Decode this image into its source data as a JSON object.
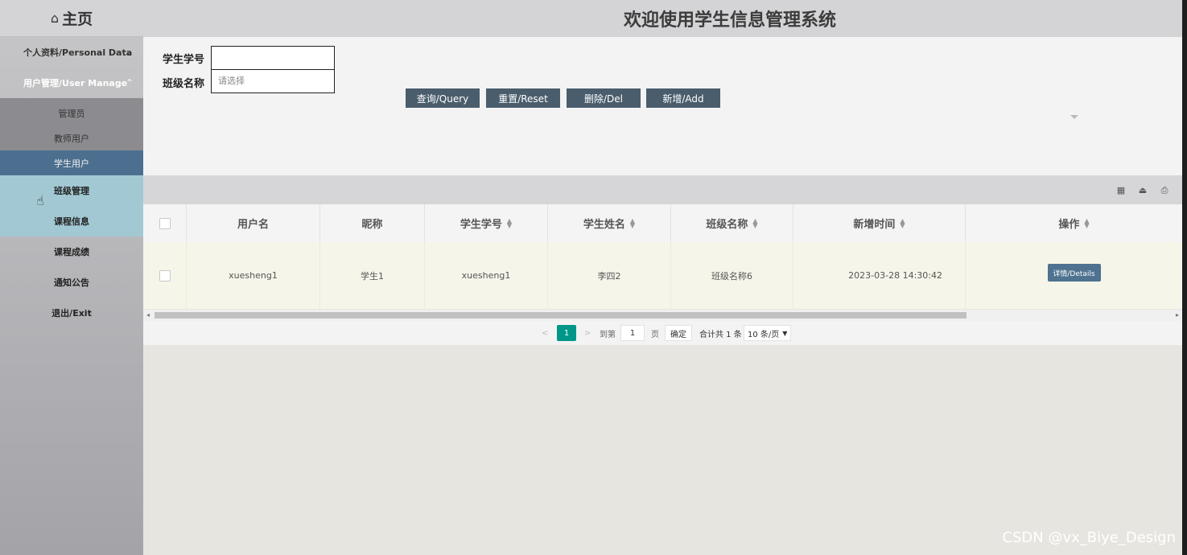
{
  "sidebar": {
    "home": {
      "icon": "home-icon",
      "label": "主页"
    },
    "menus": [
      {
        "label": "个人资料/Personal Data"
      },
      {
        "label": "用户管理/User Manage"
      }
    ],
    "sub_items": [
      {
        "label": "管理员"
      },
      {
        "label": "教师用户"
      },
      {
        "label": "学生用户"
      }
    ],
    "links": [
      {
        "label": "班级管理"
      },
      {
        "label": "课程信息"
      },
      {
        "label": "课程成绩"
      },
      {
        "label": "通知公告"
      },
      {
        "label": "退出/Exit"
      }
    ]
  },
  "header": {
    "title": "欢迎使用学生信息管理系统"
  },
  "search": {
    "student_id_label": "学生学号",
    "student_id_value": "",
    "class_label": "班级名称",
    "class_placeholder": "请选择",
    "buttons": {
      "query": "查询/Query",
      "reset": "重置/Reset",
      "delete": "删除/Del",
      "add": "新增/Add"
    }
  },
  "table": {
    "columns": [
      "用户名",
      "昵称",
      "学生学号",
      "学生姓名",
      "班级名称",
      "新增时间",
      "操作"
    ],
    "rows": [
      {
        "username": "xuesheng1",
        "nickname": "学生1",
        "student_id": "xuesheng1",
        "student_name": "李四2",
        "class_name": "班级名称6",
        "created": "2023-03-28 14:30:42",
        "action": "详情/Details"
      }
    ]
  },
  "pagination": {
    "prev": "<",
    "current": "1",
    "next": ">",
    "goto_label": "到第",
    "goto_value": "1",
    "page_unit": "页",
    "confirm": "确定",
    "total": "合计共 1 条",
    "page_size": "10 条/页"
  },
  "watermark": "CSDN @vx_Biye_Design",
  "colors": {
    "accent": "#009688",
    "button": "#4a5d6c",
    "active_sidebar": "#4d6f8f",
    "hover_sidebar": "#a2c8d4"
  }
}
